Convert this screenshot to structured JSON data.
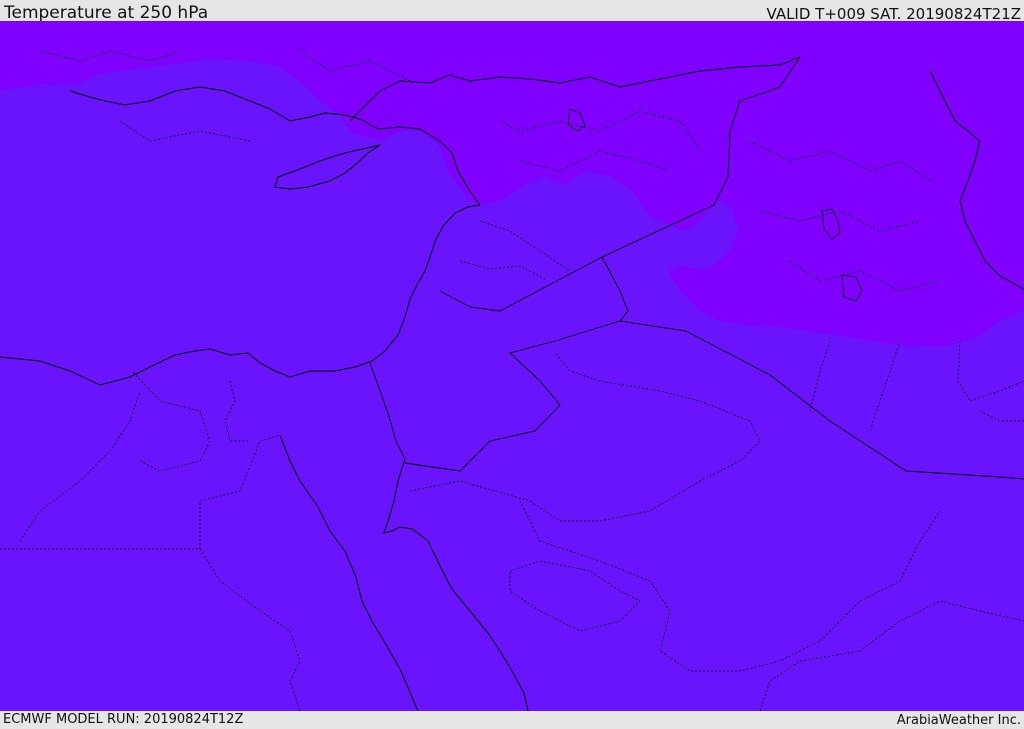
{
  "header": {
    "title": "Temperature at 250 hPa",
    "valid_time": "VALID T+009 SAT. 20190824T21Z"
  },
  "footer": {
    "model_run": "ECMWF MODEL RUN: 20190824T12Z",
    "credit": "ArabiaWeather Inc."
  },
  "colors": {
    "cold_band": "#6a14fe",
    "colder_band": "#7f00fe",
    "coastline": "#000000",
    "background": "#e6e6e6"
  }
}
